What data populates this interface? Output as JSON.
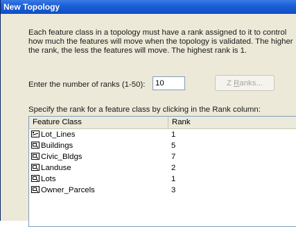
{
  "window": {
    "title": "New Topology"
  },
  "description": {
    "lines": [
      "Each feature class in a topology must have a rank assigned to it to control",
      "how much the features will move when the topology is validated. The higher",
      "the rank, the less the features will move. The highest rank is 1."
    ]
  },
  "ranks": {
    "label": "Enter the number of ranks  (1-50):",
    "value": "10",
    "button_label_prefix": "Z ",
    "button_label_mnemonic": "R",
    "button_label_suffix": "anks..."
  },
  "specify_text": "Specify the rank for a feature class by clicking in the Rank column:",
  "table": {
    "columns": [
      "Feature Class",
      "Rank"
    ],
    "rows": [
      {
        "icon": "line-feature-class-icon",
        "name": "Lot_Lines",
        "rank": "1"
      },
      {
        "icon": "polygon-feature-class-icon",
        "name": "Buildings",
        "rank": "5"
      },
      {
        "icon": "polygon-feature-class-icon",
        "name": "Civic_Bldgs",
        "rank": "7"
      },
      {
        "icon": "polygon-feature-class-icon",
        "name": "Landuse",
        "rank": "2"
      },
      {
        "icon": "polygon-feature-class-icon",
        "name": "Lots",
        "rank": "1"
      },
      {
        "icon": "polygon-feature-class-icon",
        "name": "Owner_Parcels",
        "rank": "3"
      }
    ]
  }
}
